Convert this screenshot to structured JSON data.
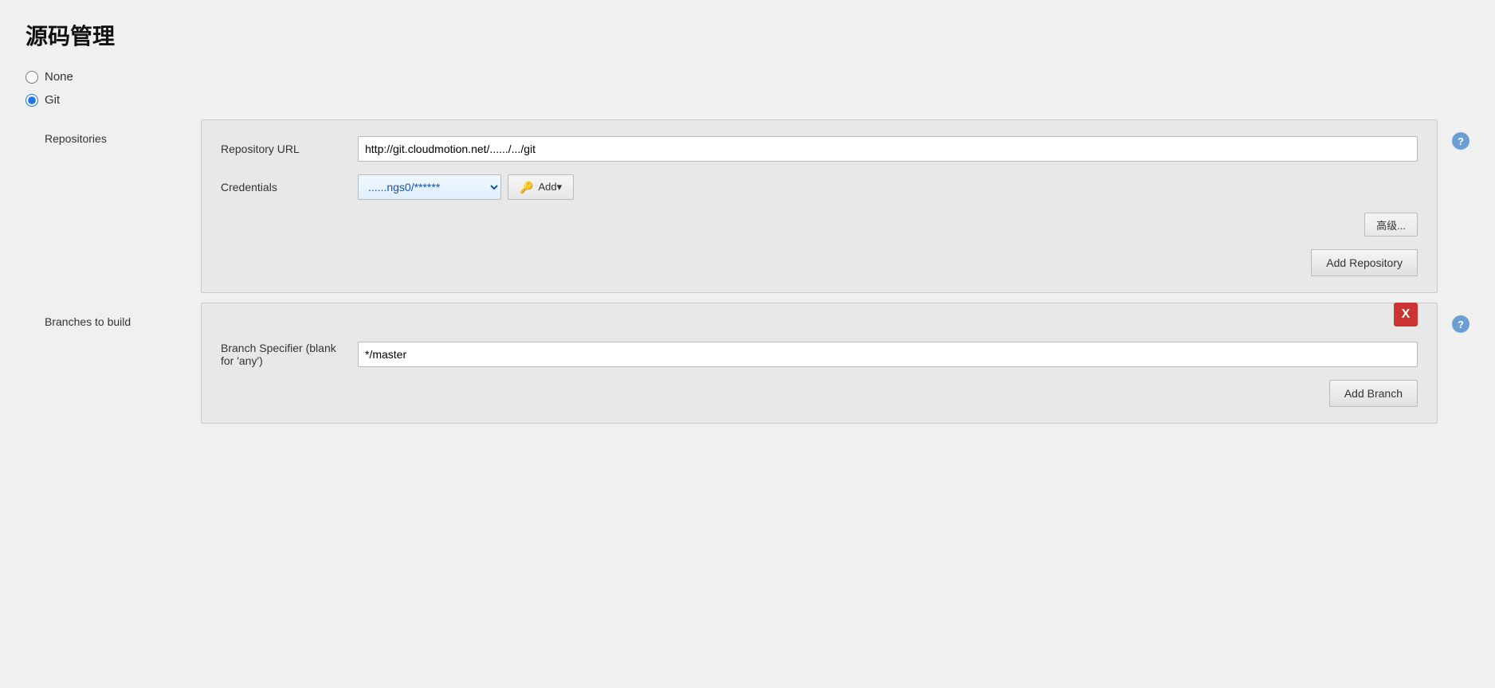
{
  "page": {
    "title": "源码管理"
  },
  "scm_options": {
    "none": {
      "label": "None",
      "selected": false
    },
    "git": {
      "label": "Git",
      "selected": true
    }
  },
  "repositories": {
    "section_label": "Repositories",
    "help_icon": "?",
    "repository_url": {
      "label": "Repository URL",
      "value": "http://git.cloudmotion.net/....../.../git",
      "placeholder": "Repository URL"
    },
    "credentials": {
      "label": "Credentials",
      "select_value": "......ngs0/******",
      "add_button_label": "Add▾",
      "key_icon": "🔑"
    },
    "advanced_btn": "高级...",
    "add_repository_btn": "Add Repository"
  },
  "branches": {
    "section_label": "Branches to build",
    "help_icon": "?",
    "delete_btn": "X",
    "branch_specifier": {
      "label": "Branch Specifier (blank for 'any')",
      "value": "*/master",
      "placeholder": "*/master"
    },
    "add_branch_btn": "Add Branch"
  }
}
